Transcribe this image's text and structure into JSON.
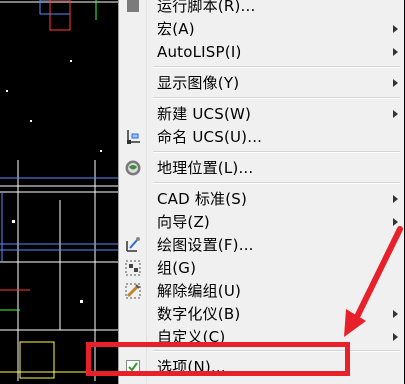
{
  "menu": {
    "items": [
      {
        "label": "运行脚本(R)...",
        "submenu": false,
        "icon": "script-icon"
      },
      {
        "label": "宏(A)",
        "submenu": true,
        "icon": ""
      },
      {
        "label": "AutoLISP(I)",
        "submenu": true,
        "icon": ""
      },
      {
        "label": "显示图像(Y)",
        "submenu": true,
        "icon": ""
      },
      {
        "label": "新建 UCS(W)",
        "submenu": true,
        "icon": ""
      },
      {
        "label": "命名 UCS(U)...",
        "submenu": false,
        "icon": "ucs-icon"
      },
      {
        "label": "地理位置(L)...",
        "submenu": false,
        "icon": "globe-icon"
      },
      {
        "label": "CAD 标准(S)",
        "submenu": true,
        "icon": ""
      },
      {
        "label": "向导(Z)",
        "submenu": true,
        "icon": ""
      },
      {
        "label": "绘图设置(F)...",
        "submenu": false,
        "icon": "drafting-settings-icon"
      },
      {
        "label": "组(G)",
        "submenu": false,
        "icon": "group-icon"
      },
      {
        "label": "解除编组(U)",
        "submenu": false,
        "icon": "ungroup-icon"
      },
      {
        "label": "数字化仪(B)",
        "submenu": true,
        "icon": ""
      },
      {
        "label": "自定义(C)",
        "submenu": true,
        "icon": ""
      },
      {
        "label": "选项(N)...",
        "submenu": false,
        "icon": "checkbox-icon"
      }
    ]
  },
  "colors": {
    "highlight": "#e8202a",
    "menu_bg": "#f0f0f0",
    "canvas_bg": "#000000"
  }
}
